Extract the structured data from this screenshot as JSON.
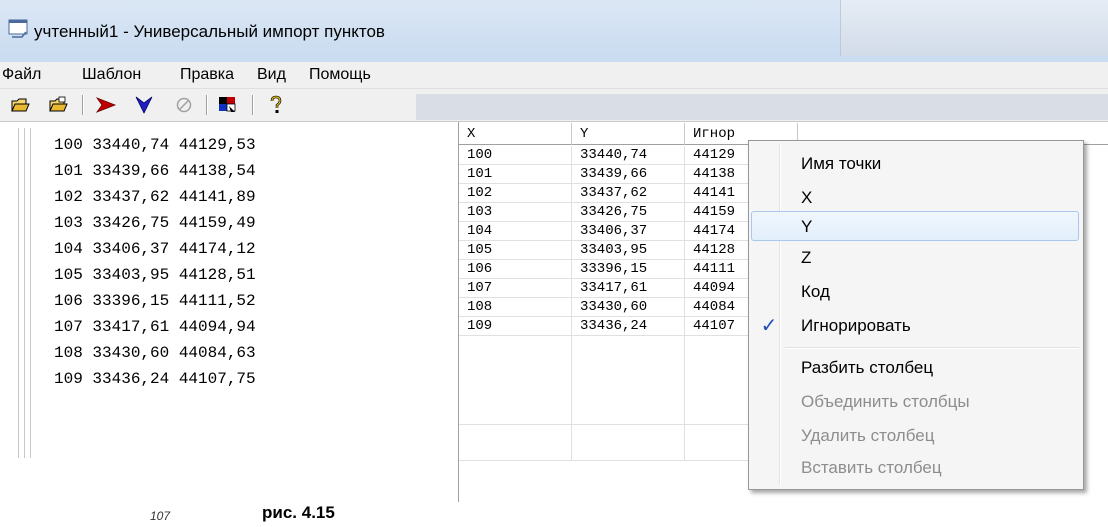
{
  "window": {
    "title": "учтенный1 - Универсальный импорт пунктов",
    "icon": "app-window-icon"
  },
  "menubar": {
    "items": [
      "Файл",
      "Шаблон",
      "Правка",
      "Вид",
      "Помощь"
    ]
  },
  "toolbar": {
    "buttons": [
      {
        "icon": "open-folder-icon"
      },
      {
        "icon": "save-folder-icon"
      },
      {
        "icon": "import-arrow-icon",
        "color": "#c00000"
      },
      {
        "icon": "down-arrow-icon",
        "color": "#2020c0"
      },
      {
        "icon": "disabled-cancel-icon"
      },
      {
        "icon": "template-icon"
      },
      {
        "icon": "help-icon"
      }
    ]
  },
  "raw_text": [
    "100 33440,74 44129,53",
    "101 33439,66 44138,54",
    "102 33437,62 44141,89",
    "103 33426,75 44159,49",
    "104 33406,37 44174,12",
    "105 33403,95 44128,51",
    "106 33396,15 44111,52",
    "107 33417,61 44094,94",
    "108 33430,60 44084,63",
    "109 33436,24 44107,75"
  ],
  "table": {
    "columns": [
      "X",
      "Y",
      "Игнор"
    ],
    "rows": [
      [
        "100",
        "33440,74",
        "44129"
      ],
      [
        "101",
        "33439,66",
        "44138"
      ],
      [
        "102",
        "33437,62",
        "44141"
      ],
      [
        "103",
        "33426,75",
        "44159"
      ],
      [
        "104",
        "33406,37",
        "44174"
      ],
      [
        "105",
        "33403,95",
        "44128"
      ],
      [
        "106",
        "33396,15",
        "44111"
      ],
      [
        "107",
        "33417,61",
        "44094"
      ],
      [
        "108",
        "33430,60",
        "44084"
      ],
      [
        "109",
        "33436,24",
        "44107"
      ]
    ]
  },
  "context_menu": {
    "items": [
      {
        "label": "Имя точки",
        "enabled": true
      },
      {
        "label": "X",
        "enabled": true
      },
      {
        "label": "Y",
        "enabled": true,
        "highlighted": true
      },
      {
        "label": "Z",
        "enabled": true
      },
      {
        "label": "Код",
        "enabled": true
      },
      {
        "label": "Игнорировать",
        "enabled": true,
        "checked": true
      },
      {
        "label": "Разбить столбец",
        "enabled": true
      },
      {
        "label": "Объединить столбцы",
        "enabled": false
      },
      {
        "label": "Удалить столбец",
        "enabled": false
      },
      {
        "label": "Вставить столбец",
        "enabled": false
      }
    ]
  },
  "caption": "рис. 4.15",
  "fragment_label": "107"
}
